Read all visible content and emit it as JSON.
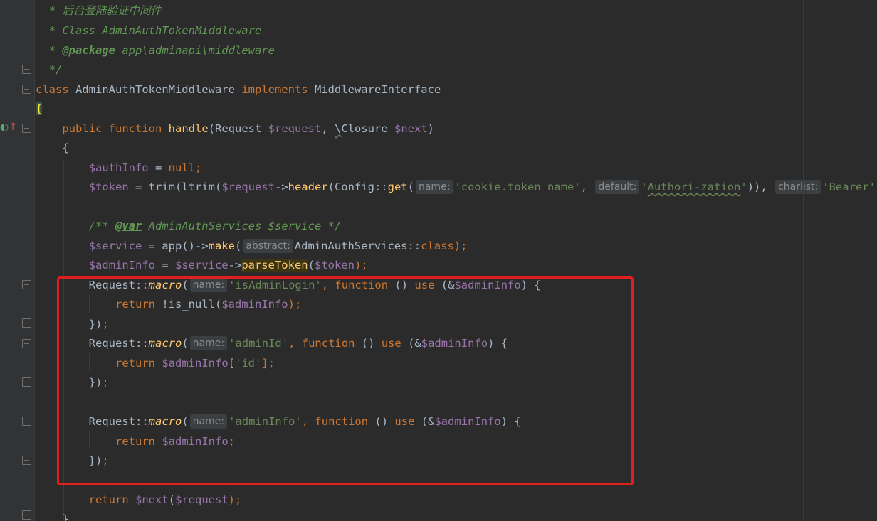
{
  "editor": {
    "language": "PHP",
    "theme_colors": {
      "background": "#2b2b2b",
      "keyword": "#cc7832",
      "function": "#ffc66d",
      "variable": "#9876aa",
      "string": "#6a8759",
      "comment": "#629755",
      "plain": "#a9b7c6",
      "annotation_border": "#e0201e"
    },
    "code": {
      "comment_line1": "* 后台登陆验证中间件",
      "comment_line2": "* Class AdminAuthTokenMiddleware",
      "comment_line3_star": "* ",
      "comment_line3_tag": "@package",
      "comment_line3_rest": " app\\adminapi\\middleware",
      "comment_line4": "*/",
      "class_kw": "class",
      "class_name": " AdminAuthTokenMiddleware ",
      "implements_kw": "implements",
      "interface_name": " MiddlewareInterface",
      "open_brace": "{",
      "handle_public": "public",
      "handle_function": "function",
      "handle_name": "handle",
      "handle_params_1": "(Request ",
      "handle_param_request": "$request",
      "handle_comma": ", ",
      "handle_backslash": "\\",
      "handle_closure": "Closure ",
      "handle_param_next": "$next",
      "handle_close": ")",
      "method_open_brace": "{",
      "authinfo_var": "$authInfo",
      "authinfo_eq": " = ",
      "null_kw": "null",
      "semicolon": ";",
      "token_var": "$token",
      "token_eq": " = trim(ltrim(",
      "token_request_var": "$request",
      "token_arrow": "->",
      "token_header": "header",
      "token_config": "(Config::",
      "token_get": "get",
      "token_paren": "(",
      "hint_name": "name:",
      "str_cookie": "'cookie.token_name'",
      "comma_space": ", ",
      "hint_default": "default:",
      "str_auth_q1": "'",
      "str_auth_word": "Authori-zation",
      "str_auth_q2": "'",
      "close_two": ")),",
      "hint_charlist": "charlist:",
      "str_bearer": "'Bearer'",
      "close_final": "));",
      "doc_open": "/** ",
      "doc_tag_var": "@var",
      "doc_rest": " AdminAuthServices $service */",
      "service_var": "$service",
      "service_eq": " = app()->",
      "make_fn": "make",
      "make_open": "(",
      "hint_abstract": "abstract:",
      "service_class": "AdminAuthServices::",
      "class_kw2": "class",
      "close_paren_semi": ");",
      "admininfo_var": "$adminInfo",
      "admininfo_eq": " = ",
      "parse_token": "parseToken",
      "token_arg_open": "(",
      "token_arg_var": "$token",
      "token_arg_close": ");",
      "request_prefix": "Request::",
      "macro_fn": "macro",
      "macro_open": "(",
      "str_is_admin_login": "'isAdminLogin'",
      "str_admin_id": "'adminId'",
      "str_admin_info": "'adminInfo'",
      "function_kw": "function",
      "empty_parens": " () ",
      "use_kw": "use",
      "use_open": " (&",
      "use_close": ") {",
      "return_kw": "return",
      "is_null_call": " !is_null(",
      "return_id_open": "[",
      "str_id": "'id'",
      "return_id_close": "];",
      "macro_close": "})",
      "return_next_var": "$next",
      "return_next_open": "(",
      "return_next_close": ");",
      "final_brace": "}"
    }
  }
}
